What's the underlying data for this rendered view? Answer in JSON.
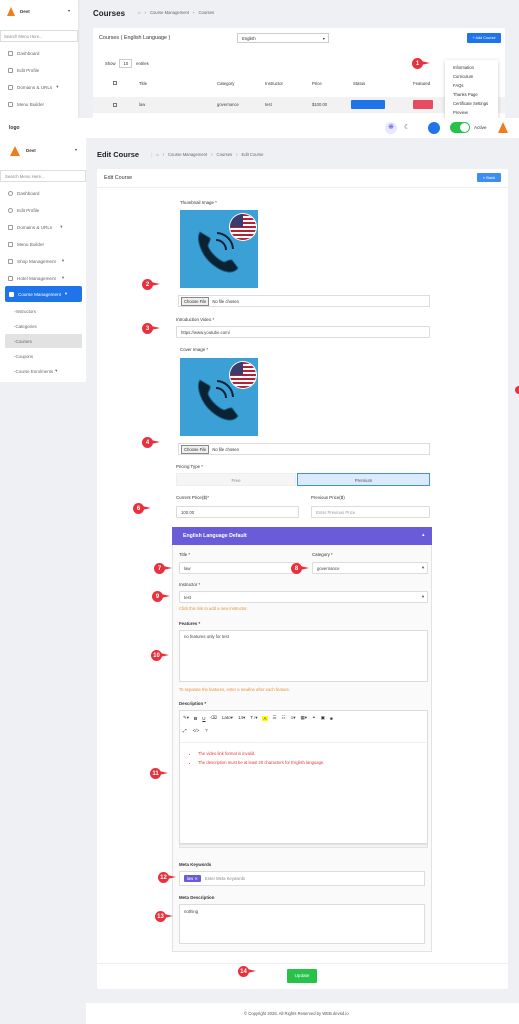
{
  "top": {
    "brand": "Devt",
    "search_placeholder": "Search Menu Here...",
    "menu": [
      "Dashboard",
      "Edit Profile",
      "Domains & URLs",
      "Menu Builder"
    ],
    "page_title": "Courses",
    "breadcrumb": [
      "Course Management",
      "Courses"
    ],
    "card_title": "Courses ( English Language )",
    "lang_select": "English",
    "add_button": "+ Add Course",
    "show_label": "Show",
    "show_value": "10",
    "entries_label": "entries",
    "columns": [
      "Title",
      "Category",
      "Instructor",
      "Price",
      "Status",
      "Featured"
    ],
    "row": {
      "title": "law",
      "category": "governance",
      "instructor": "test",
      "price": "$100.00"
    },
    "dropdown": [
      "Information",
      "Curriculum",
      "FAQs",
      "Thanks Page",
      "Certificate Settings",
      "Preview"
    ]
  },
  "topbar": {
    "logo": "logo",
    "active_label": "Active"
  },
  "sidebar": {
    "brand": "Devt",
    "search_placeholder": "Search Menu Here...",
    "items": [
      "Dashboard",
      "Edit Profile",
      "Domains & URLs",
      "Menu Builder",
      "Shop Management",
      "Hotel Management",
      "Course Management"
    ],
    "sub_items": [
      "Instructors",
      "Categories",
      "Courses",
      "Coupons",
      "Course Enrolments"
    ]
  },
  "header": {
    "title": "Edit Course",
    "breadcrumb": [
      "Course Management",
      "Courses",
      "Edit Course"
    ]
  },
  "form": {
    "card_title": "Edit Course",
    "back_label": "Back",
    "thumbnail_label": "Thumbnail Image *",
    "choose_file": "Choose File",
    "no_file": "No file chosen",
    "video_label": "Introduction Video *",
    "video_value": "https://www.youtube.com/",
    "cover_label": "Cover Image *",
    "pricing_label": "Pricing Type *",
    "pricing_free": "Free",
    "pricing_premium": "Premium",
    "current_price_label": "Current Price($)*",
    "current_price_value": "100.00",
    "previous_price_label": "Previous Price($)",
    "previous_price_placeholder": "Enter Previous Price",
    "lang_header": "English Language Default",
    "title_label": "Title *",
    "title_value": "law",
    "category_label": "Category *",
    "category_value": "governance",
    "instructor_label": "Instructor *",
    "instructor_value": "test",
    "instructor_help": "Click this link to add a new instructor.",
    "features_label": "Features *",
    "features_value": "no features only for test",
    "features_help": "To separate the features, enter a newline after each feature.",
    "description_label": "Description *",
    "toolbar": {
      "font": "Lato",
      "size": "14"
    },
    "description_bullets": [
      "The video link format is invalid.",
      "The description must be at least 20 characters for English language."
    ],
    "meta_keywords_label": "Meta Keywords",
    "meta_tag": "law",
    "meta_keywords_placeholder": "Enter Meta Keywords",
    "meta_description_label": "Meta Description",
    "meta_description_value": "nothing",
    "update_label": "Update"
  },
  "footer": {
    "text": "© Copyright 2026. All Rights Reserved by WEB.devsd.io"
  },
  "colors": {
    "primary": "#1e74e8",
    "accent_purple": "#6a5cd8",
    "green": "#28c24a",
    "marker": "#e8313d",
    "orange": "#f07c1e"
  },
  "markers": [
    "1",
    "2",
    "3",
    "4",
    "6",
    "7",
    "8",
    "9",
    "10",
    "11",
    "12",
    "13",
    "14"
  ]
}
